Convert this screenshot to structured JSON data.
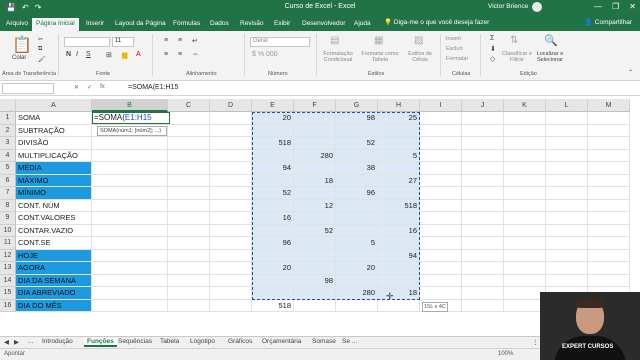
{
  "titlebar": {
    "title": "Curso de Excel  -  Excel",
    "user": "Victor Brience",
    "minimize": "—",
    "restore": "❐",
    "close": "✕"
  },
  "tabs": [
    {
      "label": "Arquivo",
      "active": false
    },
    {
      "label": "Página Inicial",
      "active": true
    },
    {
      "label": "Inserir",
      "active": false
    },
    {
      "label": "Layout da Página",
      "active": false
    },
    {
      "label": "Fórmulas",
      "active": false
    },
    {
      "label": "Dados",
      "active": false
    },
    {
      "label": "Revisão",
      "active": false
    },
    {
      "label": "Exibir",
      "active": false
    },
    {
      "label": "Desenvolvedor",
      "active": false
    },
    {
      "label": "Ajuda",
      "active": false
    }
  ],
  "tell_me": "Diga-me o que você deseja fazer",
  "share": "Compartilhar",
  "ribbon": {
    "paste": "Colar",
    "clipboard": "Área de Transferência",
    "font": "Fonte",
    "alignment": "Alinhamento",
    "number": "Número",
    "number_format": "Geral",
    "font_size": "11",
    "cond_format": "Formatação Condicional",
    "format_table": "Formatar como Tabela",
    "cell_styles": "Estilos de Célula",
    "styles": "Estilos",
    "insert": "Inserir",
    "delete": "Excluir",
    "format": "Formatar",
    "cells": "Células",
    "sort": "Classificar e Filtrar",
    "find": "Localizar e Selecionar",
    "editing": "Edição"
  },
  "formula_bar": {
    "fx": "fx",
    "content": "=SOMA(E1:H15"
  },
  "columns": [
    "A",
    "B",
    "C",
    "D",
    "E",
    "F",
    "G",
    "H",
    "I",
    "J",
    "K",
    "L",
    "M"
  ],
  "rows": [
    {
      "num": "1",
      "label": "SOMA",
      "blue": false,
      "E": "20",
      "F": "",
      "G": "98",
      "H": "25"
    },
    {
      "num": "2",
      "label": "SUBTRAÇÃO",
      "blue": false,
      "E": "",
      "F": "",
      "G": "",
      "H": ""
    },
    {
      "num": "3",
      "label": "DIVISÃO",
      "blue": false,
      "E": "518",
      "F": "",
      "G": "52",
      "H": ""
    },
    {
      "num": "4",
      "label": "MULTIPLICAÇÃO",
      "blue": false,
      "E": "",
      "F": "280",
      "G": "",
      "H": "5"
    },
    {
      "num": "5",
      "label": "MÉDIA",
      "blue": true,
      "E": "94",
      "F": "",
      "G": "38",
      "H": ""
    },
    {
      "num": "6",
      "label": "MÁXIMO",
      "blue": true,
      "E": "",
      "F": "18",
      "G": "",
      "H": "27"
    },
    {
      "num": "7",
      "label": "MÍNIMO",
      "blue": true,
      "E": "52",
      "F": "",
      "G": "96",
      "H": ""
    },
    {
      "num": "8",
      "label": "CONT. NÚM",
      "blue": false,
      "E": "",
      "F": "12",
      "G": "",
      "H": "518"
    },
    {
      "num": "9",
      "label": "CONT.VALORES",
      "blue": false,
      "E": "16",
      "F": "",
      "G": "",
      "H": ""
    },
    {
      "num": "10",
      "label": "CONTAR.VAZIO",
      "blue": false,
      "E": "",
      "F": "52",
      "G": "",
      "H": "16"
    },
    {
      "num": "11",
      "label": "CONT.SE",
      "blue": false,
      "E": "96",
      "F": "",
      "G": "5",
      "H": ""
    },
    {
      "num": "12",
      "label": "HOJE",
      "blue": true,
      "E": "",
      "F": "",
      "G": "",
      "H": "94"
    },
    {
      "num": "13",
      "label": "AGORA",
      "blue": true,
      "E": "20",
      "F": "",
      "G": "20",
      "H": ""
    },
    {
      "num": "14",
      "label": "DIA DA SEMANA",
      "blue": true,
      "E": "",
      "F": "98",
      "G": "",
      "H": ""
    },
    {
      "num": "15",
      "label": "DIA ABREVIADO",
      "blue": true,
      "E": "",
      "F": "",
      "G": "280",
      "H": "18"
    },
    {
      "num": "16",
      "label": "DIA DO MÊS",
      "blue": true,
      "E": "518",
      "F": "",
      "G": "",
      "H": ""
    }
  ],
  "active_cell": {
    "prefix": "=SOMA(",
    "ref": "E1:H15"
  },
  "tooltip": "SOMA(núm1; [núm2]; ...)",
  "size_hint": "15L x 4C",
  "sheets": [
    {
      "label": "Introdução",
      "active": false
    },
    {
      "label": "Funções",
      "active": true
    },
    {
      "label": "Sequências",
      "active": false
    },
    {
      "label": "Tabela",
      "active": false
    },
    {
      "label": "Logotipo",
      "active": false
    },
    {
      "label": "Gráficos",
      "active": false
    },
    {
      "label": "Orçamentária",
      "active": false
    },
    {
      "label": "Somase",
      "active": false
    },
    {
      "label": "Se ...",
      "active": false
    }
  ],
  "status": {
    "mode": "Apontar",
    "zoom": "100%"
  },
  "webcam_text": "EXPERT CURSOS",
  "colors": {
    "excel_green": "#217346",
    "highlight_blue": "#1e9be0",
    "range_fill": "#dde8f5"
  }
}
